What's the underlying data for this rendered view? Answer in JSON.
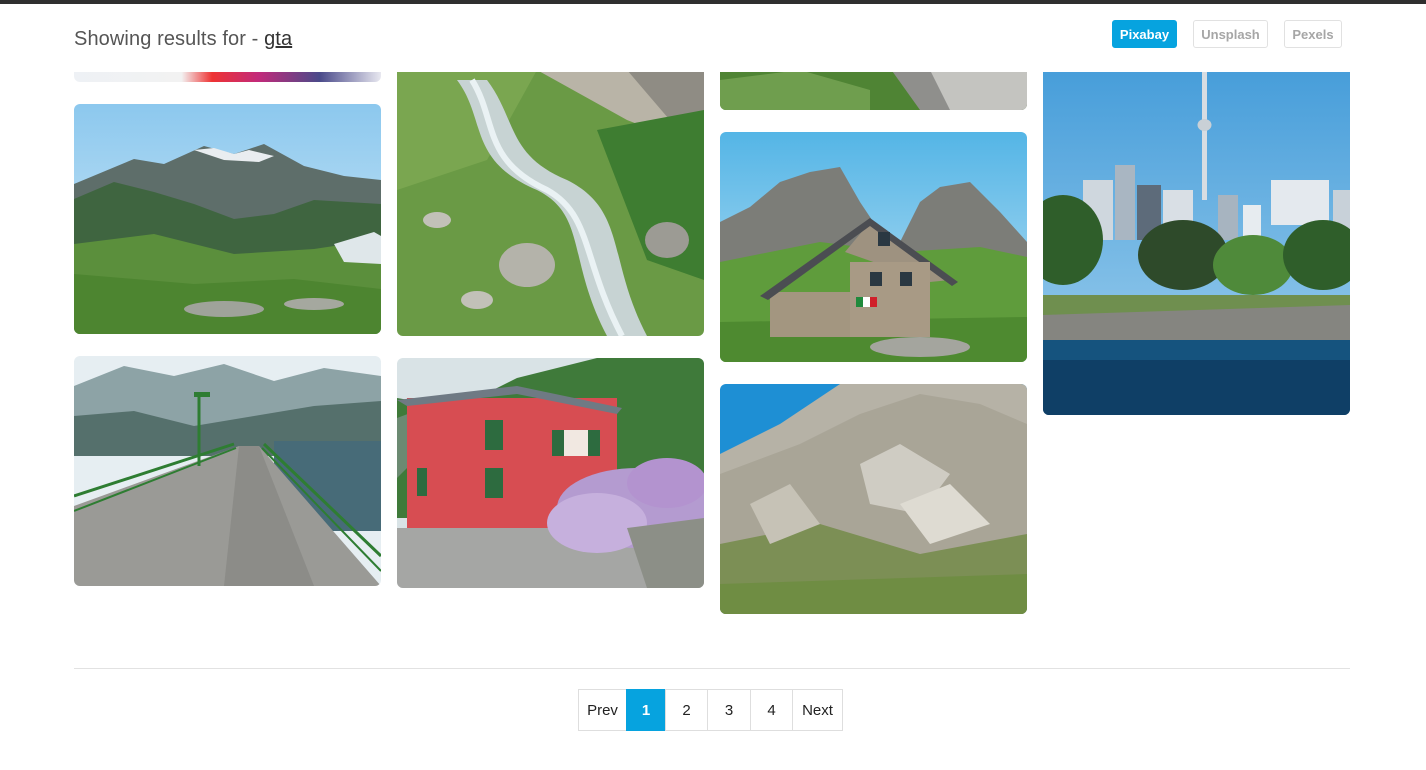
{
  "header": {
    "results_prefix": "Showing results for - ",
    "query": "gta"
  },
  "sources": [
    {
      "label": "Pixabay",
      "active": true
    },
    {
      "label": "Unsplash",
      "active": false
    },
    {
      "label": "Pexels",
      "active": false
    }
  ],
  "gallery": {
    "images": [
      {
        "subject": "colorful abstract (cropped)"
      },
      {
        "subject": "mountain valley with snowy peaks"
      },
      {
        "subject": "road along lake dam with green railing"
      },
      {
        "subject": "mountain stream with rocks"
      },
      {
        "subject": "red house with hydrangeas"
      },
      {
        "subject": "alpine grass (cropped)"
      },
      {
        "subject": "mountain hut with Italian flag"
      },
      {
        "subject": "rocky limestone mountain"
      },
      {
        "subject": "city skyline with tower by the water"
      }
    ]
  },
  "pagination": {
    "prev_label": "Prev",
    "pages": [
      "1",
      "2",
      "3",
      "4"
    ],
    "current": "1",
    "next_label": "Next"
  },
  "colors": {
    "accent": "#06a3df",
    "topbar": "#2f2f2f"
  }
}
